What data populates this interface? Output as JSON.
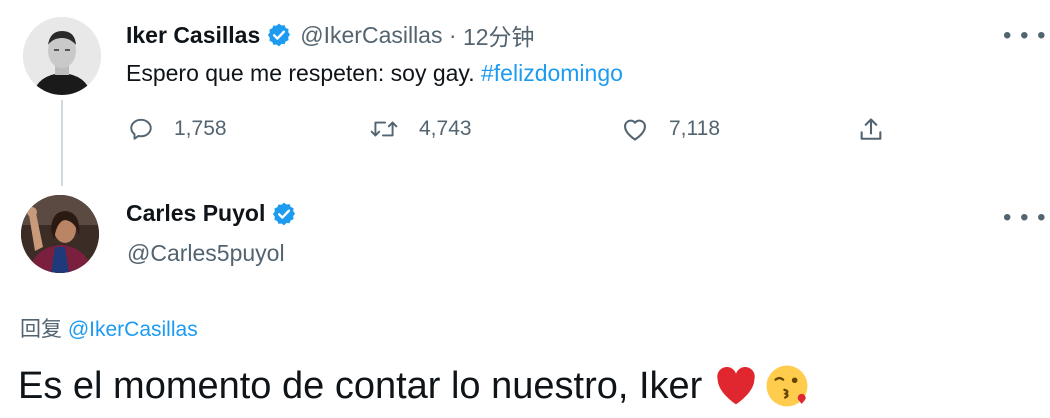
{
  "tweet": {
    "display_name": "Iker Casillas",
    "handle": "@IkerCasillas",
    "separator": " · ",
    "time": "12分钟",
    "text_plain": "Espero que me respeten: soy gay. ",
    "hashtag": "#felizdomingo",
    "replies": "1,758",
    "retweets": "4,743",
    "likes": "7,118",
    "avatar_icon": "casillas-avatar-photo",
    "verified_icon": "verified-badge-icon"
  },
  "reply": {
    "display_name": "Carles Puyol",
    "handle": "@Carles5puyol",
    "reply_prefix": "回复 ",
    "reply_mention": "@IkerCasillas",
    "text": "Es el momento de contar lo nuestro, Iker",
    "emojis": [
      "red-heart-emoji",
      "kissing-face-emoji"
    ],
    "avatar_icon": "puyol-avatar-photo"
  },
  "more_label": "• • •",
  "colors": {
    "text": "#0f1419",
    "secondary": "#536471",
    "link": "#1d9bf0",
    "verified": "#1d9bf0",
    "heart": "#e0262e"
  }
}
